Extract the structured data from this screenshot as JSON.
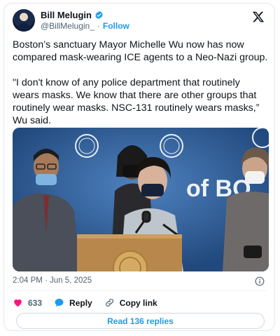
{
  "author": {
    "name": "Bill Melugin",
    "handle": "@BillMelugin_",
    "separator": "·",
    "follow_label": "Follow"
  },
  "tweet": {
    "text": "Boston’s sanctuary Mayor Michelle Wu now has now compared mask-wearing ICE agents to a Neo-Nazi group.\n\n\"I don't know of any police department that routinely wears masks. We know that there are other groups that routinely wear masks. NSC-131 routinely wears masks,” Wu said.",
    "timestamp": "2:04 PM · Jun 5, 2025"
  },
  "media": {
    "backdrop_text": "of BO"
  },
  "actions": {
    "like_count": "633",
    "reply_label": "Reply",
    "copy_link_label": "Copy link"
  },
  "read_replies_label": "Read 136 replies",
  "colors": {
    "accent": "#1d9bf0",
    "like": "#f91880",
    "text": "#0f1419",
    "muted": "#536471"
  },
  "icons": [
    "verified-icon",
    "x-logo-icon",
    "info-icon",
    "heart-icon",
    "reply-icon",
    "link-icon"
  ]
}
